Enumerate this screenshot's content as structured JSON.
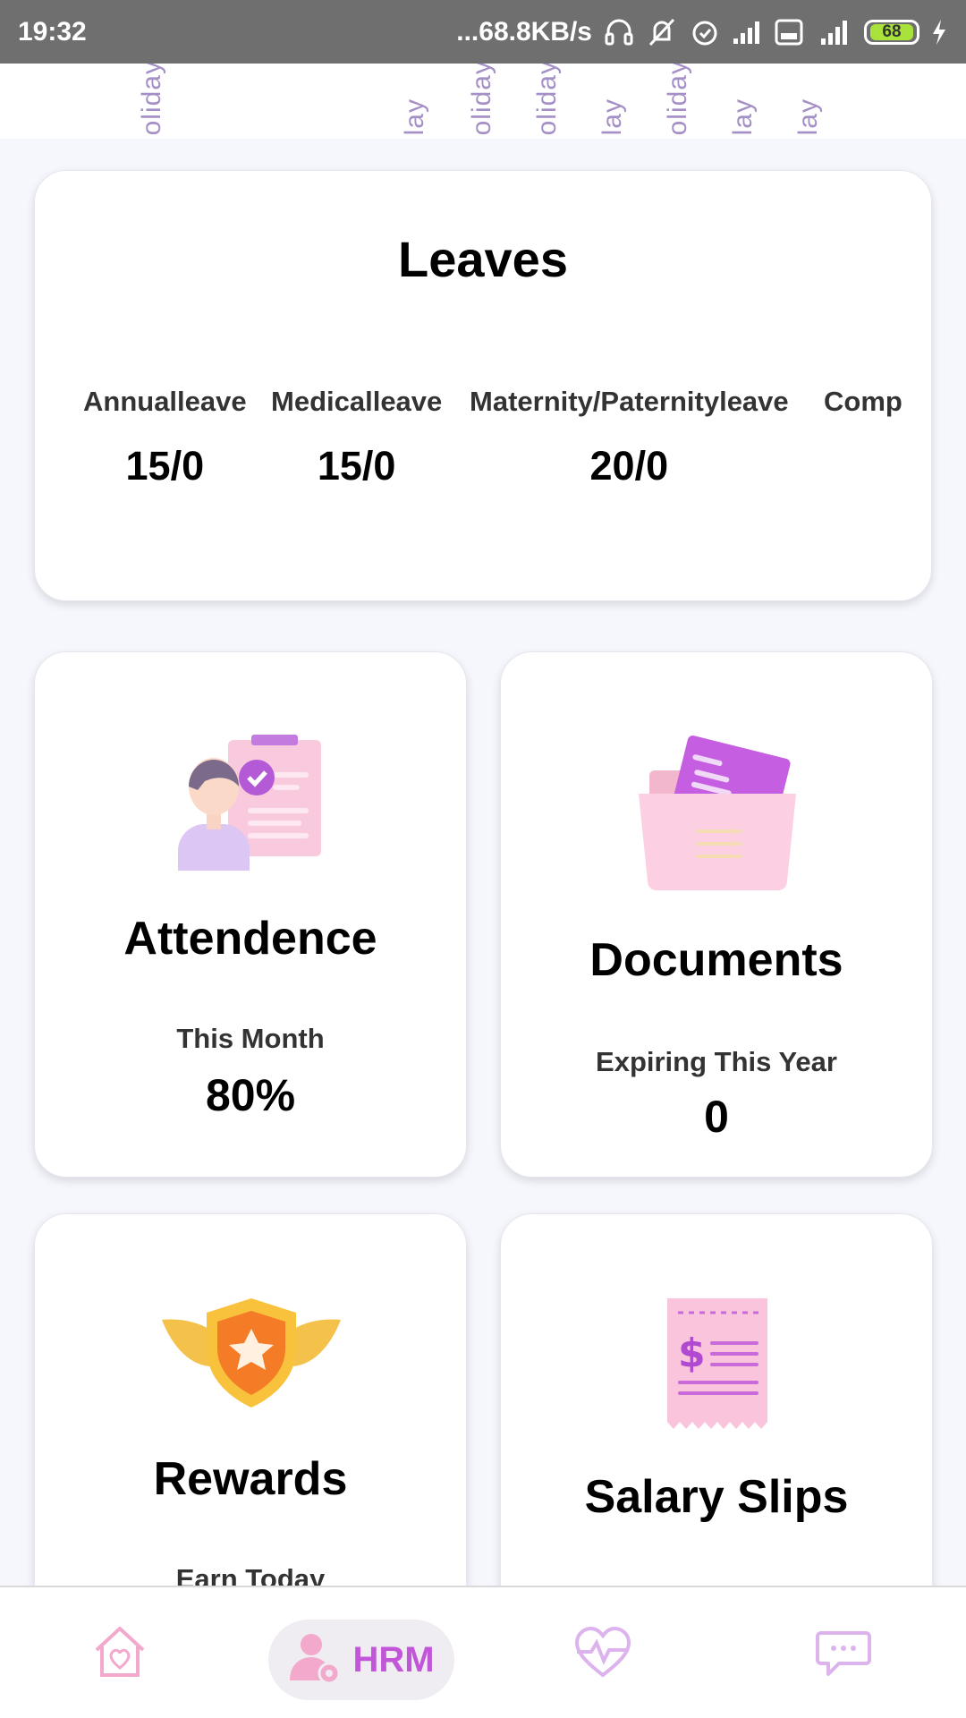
{
  "status_bar": {
    "time": "19:32",
    "network_speed": "...68.8KB/s",
    "battery": "68",
    "icons": [
      "headphones-icon",
      "mute-icon",
      "alarm-icon",
      "signal-icon",
      "volte-icon",
      "4g-signal-icon",
      "battery-icon",
      "charging-icon"
    ]
  },
  "calendar_strip": {
    "labels": [
      "oliday",
      "lay",
      "oliday",
      "oliday",
      "lay",
      "oliday",
      "lay",
      "lay"
    ]
  },
  "leaves": {
    "title": "Leaves",
    "items": [
      {
        "label": "Annualleave",
        "value": "15/0"
      },
      {
        "label": "Medicalleave",
        "value": "15/0"
      },
      {
        "label": "Maternity/Paternityleave",
        "value": "20/0"
      },
      {
        "label": "Comp",
        "value": ""
      }
    ]
  },
  "attendance": {
    "title": "Attendence",
    "subtitle": "This Month",
    "value": "80%",
    "icon": "attendance-clipboard-icon"
  },
  "documents": {
    "title": "Documents",
    "subtitle": "Expiring This Year",
    "value": "0",
    "icon": "documents-folder-icon"
  },
  "rewards": {
    "title": "Rewards",
    "subtitle": "Earn Today",
    "icon": "reward-badge-icon"
  },
  "salary": {
    "title": "Salary Slips",
    "icon": "salary-receipt-icon"
  },
  "bottom_nav": {
    "items": [
      {
        "name": "home",
        "icon": "home-heart-icon"
      },
      {
        "name": "hrm",
        "label": "HRM",
        "icon": "hrm-user-gear-icon"
      },
      {
        "name": "health",
        "icon": "heart-pulse-icon"
      },
      {
        "name": "chat",
        "icon": "chat-bubble-icon"
      }
    ]
  },
  "colors": {
    "accent": "#c256d9",
    "status_bar": "#6f6f6f",
    "background": "#f6f6fd",
    "pink_icon": "#f7b6d4"
  }
}
